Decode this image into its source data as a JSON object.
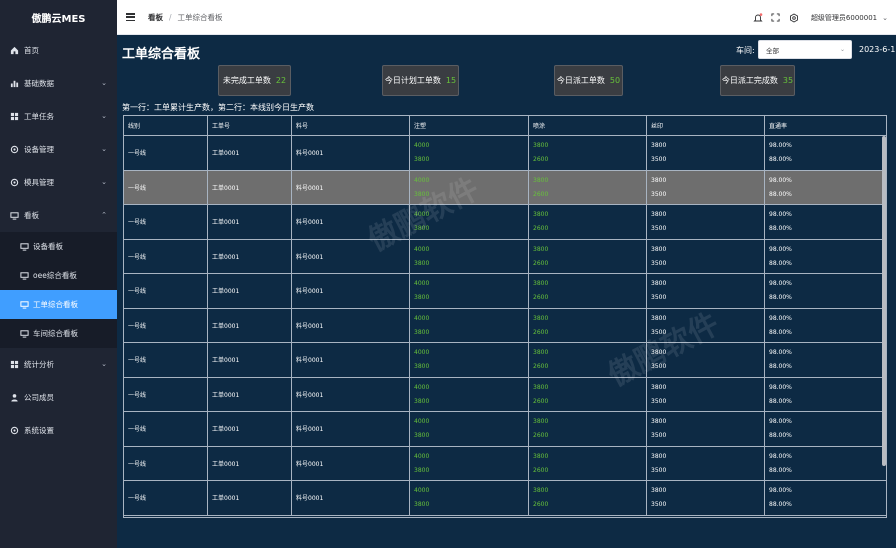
{
  "app": {
    "logo": "傲鹏云MES"
  },
  "sidebar": {
    "items": [
      {
        "label": "首页",
        "icon": "home-icon"
      },
      {
        "label": "基础数据",
        "icon": "bar-chart-icon",
        "has_children": true
      },
      {
        "label": "工单任务",
        "icon": "grid-icon",
        "has_children": true
      },
      {
        "label": "设备管理",
        "icon": "gear-icon",
        "has_children": true
      },
      {
        "label": "模具管理",
        "icon": "gear-icon",
        "has_children": true
      },
      {
        "label": "看板",
        "icon": "board-icon",
        "has_children": true,
        "expanded": true
      },
      {
        "label": "统计分析",
        "icon": "grid-icon",
        "has_children": true
      },
      {
        "label": "公司成员",
        "icon": "user-icon"
      },
      {
        "label": "系统设置",
        "icon": "gear-icon"
      }
    ],
    "board_children": [
      {
        "label": "设备看板",
        "icon": "board-icon"
      },
      {
        "label": "oee综合看板",
        "icon": "board-icon"
      },
      {
        "label": "工单综合看板",
        "icon": "board-icon",
        "active": true
      },
      {
        "label": "车间综合看板",
        "icon": "board-icon"
      }
    ]
  },
  "header": {
    "breadcrumb": [
      "看板",
      "工单综合看板"
    ],
    "separator": "/",
    "user": "超级管理员6000001"
  },
  "main": {
    "title": "工单综合看板",
    "workshop_label": "车间:",
    "workshop_value": "全部",
    "date": "2023-6-1",
    "kpis": [
      {
        "label": "未完成工单数",
        "value": "22"
      },
      {
        "label": "今日计划工单数",
        "value": "15"
      },
      {
        "label": "今日派工单数",
        "value": "50"
      },
      {
        "label": "今日派工完成数",
        "value": "35"
      }
    ],
    "note": "第一行：工单累计生产数，第二行：本线别今日生产数",
    "watermark": "傲鹏软件",
    "table": {
      "columns": [
        "线别",
        "工单号",
        "料号",
        "注塑",
        "喷涂",
        "丝印",
        "直通率"
      ],
      "rows": [
        [
          "一号线",
          "工单0001",
          "料号0001",
          [
            "4000",
            "3800"
          ],
          [
            "3800",
            "2600"
          ],
          [
            "3800",
            "3500"
          ],
          [
            "98.00%",
            "88.00%"
          ]
        ],
        [
          "一号线",
          "工单0001",
          "料号0001",
          [
            "4000",
            "3800"
          ],
          [
            "3800",
            "2600"
          ],
          [
            "3800",
            "3500"
          ],
          [
            "98.00%",
            "88.00%"
          ]
        ],
        [
          "一号线",
          "工单0001",
          "料号0001",
          [
            "4000",
            "3800"
          ],
          [
            "3800",
            "2600"
          ],
          [
            "3800",
            "3500"
          ],
          [
            "98.00%",
            "88.00%"
          ]
        ],
        [
          "一号线",
          "工单0001",
          "料号0001",
          [
            "4000",
            "3800"
          ],
          [
            "3800",
            "2600"
          ],
          [
            "3800",
            "3500"
          ],
          [
            "98.00%",
            "88.00%"
          ]
        ],
        [
          "一号线",
          "工单0001",
          "料号0001",
          [
            "4000",
            "3800"
          ],
          [
            "3800",
            "2600"
          ],
          [
            "3800",
            "3500"
          ],
          [
            "98.00%",
            "88.00%"
          ]
        ],
        [
          "一号线",
          "工单0001",
          "料号0001",
          [
            "4000",
            "3800"
          ],
          [
            "3800",
            "2600"
          ],
          [
            "3800",
            "3500"
          ],
          [
            "98.00%",
            "88.00%"
          ]
        ],
        [
          "一号线",
          "工单0001",
          "料号0001",
          [
            "4000",
            "3800"
          ],
          [
            "3800",
            "2600"
          ],
          [
            "3800",
            "3500"
          ],
          [
            "98.00%",
            "88.00%"
          ]
        ],
        [
          "一号线",
          "工单0001",
          "料号0001",
          [
            "4000",
            "3800"
          ],
          [
            "3800",
            "2600"
          ],
          [
            "3800",
            "3500"
          ],
          [
            "98.00%",
            "88.00%"
          ]
        ],
        [
          "一号线",
          "工单0001",
          "料号0001",
          [
            "4000",
            "3800"
          ],
          [
            "3800",
            "2600"
          ],
          [
            "3800",
            "3500"
          ],
          [
            "98.00%",
            "88.00%"
          ]
        ],
        [
          "一号线",
          "工单0001",
          "料号0001",
          [
            "4000",
            "3800"
          ],
          [
            "3800",
            "2600"
          ],
          [
            "3800",
            "3500"
          ],
          [
            "98.00%",
            "88.00%"
          ]
        ],
        [
          "一号线",
          "工单0001",
          "料号0001",
          [
            "4000",
            "3800"
          ],
          [
            "3800",
            "2600"
          ],
          [
            "3800",
            "3500"
          ],
          [
            "98.00%",
            "88.00%"
          ]
        ]
      ],
      "highlight_row": 1
    }
  },
  "colors": {
    "sidebar_bg": "#1f2533",
    "active_menu": "#409eff",
    "main_bg": "#0d2a44",
    "green": "#67c23a"
  }
}
